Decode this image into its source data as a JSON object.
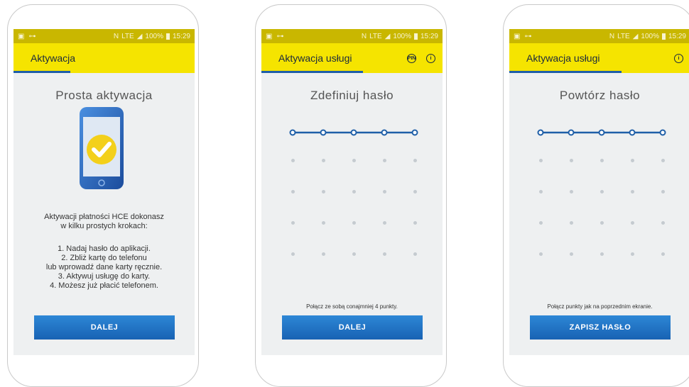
{
  "status": {
    "time": "15:29",
    "battery": "100%",
    "net": "LTE",
    "nfc": "N"
  },
  "screen1": {
    "title": "Aktywacja",
    "heading": "Prosta aktywacja",
    "intro": [
      "Aktywacji płatności HCE dokonasz",
      "w kilku prostych krokach:"
    ],
    "steps": [
      "1. Nadaj hasło do aplikacji.",
      "2. Zbliż kartę do telefonu",
      "lub wprowadź dane karty ręcznie.",
      "3. Aktywuj usługę do karty.",
      "4. Możesz już płacić telefonem."
    ],
    "button": "DALEJ",
    "progress": 0.31
  },
  "screen2": {
    "title": "Aktywacja usługi",
    "icons": [
      "pin-icon",
      "info-icon"
    ],
    "pin_label": "PIN",
    "info_label": "i",
    "heading": "Zdefiniuj hasło",
    "hint": "Połącz ze sobą conajmniej 4 punkty.",
    "button": "DALEJ",
    "progress": 0.56
  },
  "screen3": {
    "title": "Aktywacja usługi",
    "icons": [
      "info-icon"
    ],
    "info_label": "i",
    "heading": "Powtórz hasło",
    "hint": "Połącz punkty jak na poprzednim ekranie.",
    "button": "ZAPISZ HASŁO",
    "progress": 0.62
  },
  "colors": {
    "brand_yellow": "#f5e400",
    "status_yellow": "#c9b700",
    "accent_blue": "#1f5fa8",
    "button_blue": "#2279c9"
  }
}
